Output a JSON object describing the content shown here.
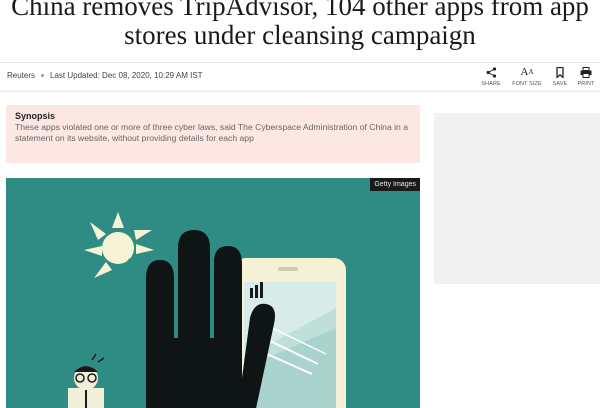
{
  "article": {
    "headline": "China removes TripAdvisor, 104 other apps from app stores under cleansing campaign",
    "source": "Reuters",
    "last_updated": "Last Updated: Dec 08, 2020, 10:29 AM IST"
  },
  "tools": {
    "share": "SHARE",
    "font_size": "FONT SIZE",
    "save": "SAVE",
    "print": "PRINT"
  },
  "synopsis": {
    "title": "Synopsis",
    "text": "These apps violated one or more of three cyber laws, said The Cyberspace Administration of China in a statement on its website, without providing details for each app"
  },
  "image": {
    "credit": "Getty Images"
  },
  "colors": {
    "synopsis_bg": "#fde7e2",
    "hero_bg": "#2f8c84"
  }
}
